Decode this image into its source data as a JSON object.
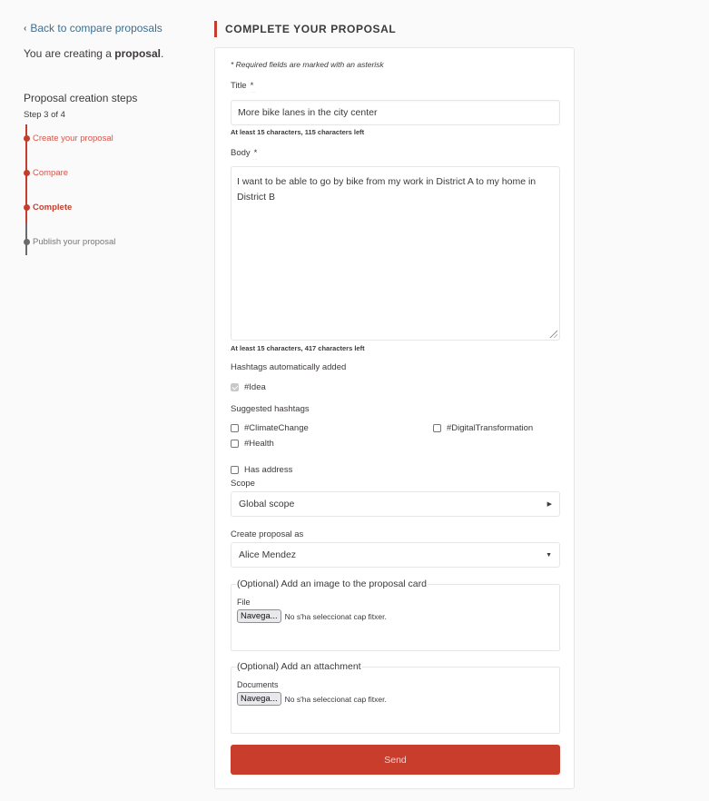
{
  "sidebar": {
    "back_link": "Back to compare proposals",
    "creating_prefix": "You are creating a ",
    "creating_bold": "proposal",
    "creating_suffix": ".",
    "steps_title": "Proposal creation steps",
    "steps_count": "Step 3 of 4",
    "steps": [
      {
        "label": "Create your proposal",
        "state": "done"
      },
      {
        "label": "Compare",
        "state": "done"
      },
      {
        "label": "Complete",
        "state": "active"
      },
      {
        "label": "Publish your proposal",
        "state": "pending"
      }
    ]
  },
  "main": {
    "title": "COMPLETE YOUR PROPOSAL",
    "required_note": "* Required fields are marked with an asterisk",
    "title_field": {
      "label": "Title",
      "asterisk": "*",
      "value": "More bike lanes in the city center",
      "help": "At least 15 characters, 115 characters left"
    },
    "body_field": {
      "label": "Body",
      "asterisk": "*",
      "value": "I want to be able to go by bike from my work in District A to my home in District B",
      "help": "At least 15 characters, 417 characters left"
    },
    "auto_hashtags": {
      "label": "Hashtags automatically added",
      "items": [
        {
          "label": "#Idea",
          "checked": true,
          "disabled": true
        }
      ]
    },
    "suggested_hashtags": {
      "label": "Suggested hashtags",
      "items": [
        {
          "label": "#ClimateChange",
          "checked": false
        },
        {
          "label": "#DigitalTransformation",
          "checked": false
        },
        {
          "label": "#Health",
          "checked": false
        }
      ]
    },
    "has_address": {
      "label": "Has address",
      "checked": false
    },
    "scope": {
      "label": "Scope",
      "value": "Global scope"
    },
    "create_as": {
      "label": "Create proposal as",
      "value": "Alice Mendez"
    },
    "image_fieldset": {
      "legend": "(Optional) Add an image to the proposal card",
      "file_label": "File",
      "button": "Navega...",
      "no_file": "No s'ha seleccionat cap fitxer."
    },
    "attachment_fieldset": {
      "legend": "(Optional) Add an attachment",
      "file_label": "Documents",
      "button": "Navega...",
      "no_file": "No s'ha seleccionat cap fitxer."
    },
    "send_button": "Send"
  },
  "colors": {
    "accent": "#c83d2b",
    "link": "#3e6e8f",
    "text": "#3d393c"
  },
  "icons": {
    "back": "chevron-left-icon",
    "scope_arrow": "caret-right-icon",
    "select_arrow": "caret-down-icon"
  }
}
